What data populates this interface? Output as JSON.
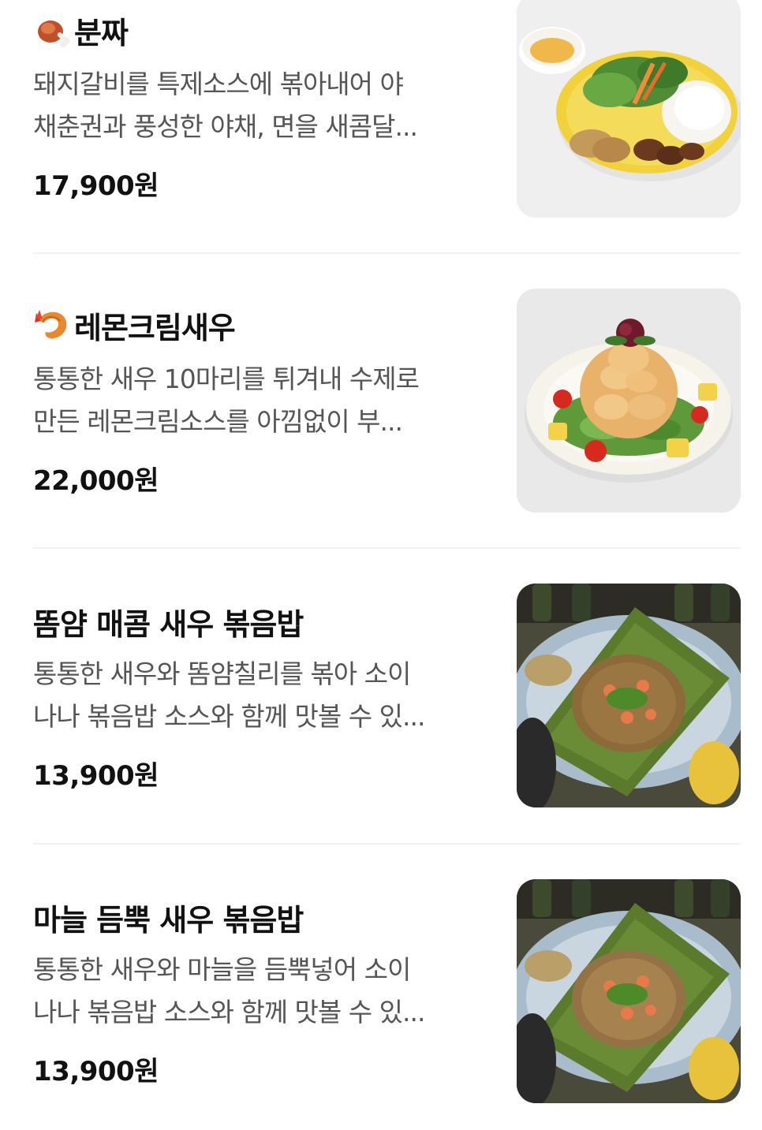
{
  "menu": {
    "items": [
      {
        "icon": "meat-on-bone-icon",
        "title": "분짜",
        "desc_line1": "돼지갈비를 특제소스에 볶아내어 야",
        "desc_line2": "채춘권과 풍성한 야채, 면을 새콤달...",
        "price": "17,900원",
        "photo": "bun-cha-plate-photo"
      },
      {
        "icon": "fried-shrimp-icon",
        "title": "레몬크림새우",
        "desc_line1": "통통한 새우 10마리를 튀겨내 수제로",
        "desc_line2": "만든 레몬크림소스를 아낌없이 부...",
        "price": "22,000원",
        "photo": "lemon-cream-shrimp-photo"
      },
      {
        "title": "똠얌 매콤 새우 볶음밥",
        "desc_line1": "통통한 새우와 똠얌칠리를 볶아 소이",
        "desc_line2": "나나 볶음밥 소스와 함께 맛볼 수 있...",
        "price": "13,900원",
        "photo": "tom-yum-shrimp-fried-rice-photo"
      },
      {
        "title": "마늘 듬뿍 새우 볶음밥",
        "desc_line1": "통통한 새우와 마늘을 듬뿍넣어 소이",
        "desc_line2": "나나 볶음밥 소스와 함께 맛볼 수 있...",
        "price": "13,900원",
        "photo": "garlic-shrimp-fried-rice-photo"
      }
    ]
  },
  "colors": {
    "title": "#111111",
    "description": "#555555",
    "price": "#111111",
    "divider": "#f1f1f1",
    "photo_placeholder": "#eeeeee"
  }
}
